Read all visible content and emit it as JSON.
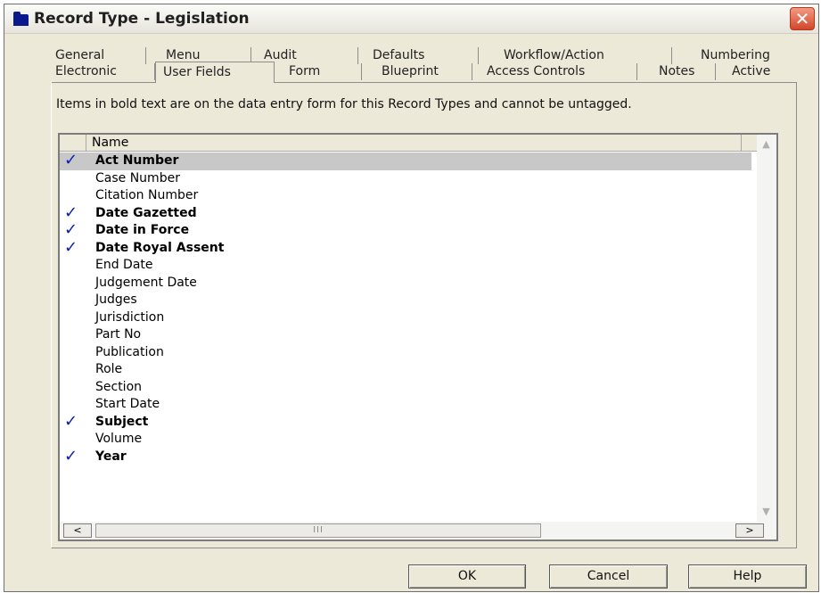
{
  "window": {
    "title": "Record Type - Legislation",
    "close_glyph": "✕"
  },
  "tabs": {
    "row1": [
      "General",
      "Menu",
      "Audit",
      "Defaults",
      "Workflow/Action",
      "Numbering"
    ],
    "row2": [
      "Electronic",
      "User Fields",
      "Form",
      "Blueprint",
      "Access Controls",
      "Notes",
      "Active"
    ],
    "active": "User Fields"
  },
  "info_text": "Items in bold text are on the data entry form for this Record Types and cannot be untagged.",
  "list": {
    "column_header": "Name",
    "check_glyph": "✓",
    "items": [
      {
        "label": "Act Number",
        "checked": true,
        "bold": true,
        "selected": true
      },
      {
        "label": "Case Number",
        "checked": false,
        "bold": false,
        "selected": false
      },
      {
        "label": "Citation Number",
        "checked": false,
        "bold": false,
        "selected": false
      },
      {
        "label": "Date Gazetted",
        "checked": true,
        "bold": true,
        "selected": false
      },
      {
        "label": "Date in Force",
        "checked": true,
        "bold": true,
        "selected": false
      },
      {
        "label": "Date Royal Assent",
        "checked": true,
        "bold": true,
        "selected": false
      },
      {
        "label": "End Date",
        "checked": false,
        "bold": false,
        "selected": false
      },
      {
        "label": "Judgement Date",
        "checked": false,
        "bold": false,
        "selected": false
      },
      {
        "label": "Judges",
        "checked": false,
        "bold": false,
        "selected": false
      },
      {
        "label": "Jurisdiction",
        "checked": false,
        "bold": false,
        "selected": false
      },
      {
        "label": "Part No",
        "checked": false,
        "bold": false,
        "selected": false
      },
      {
        "label": "Publication",
        "checked": false,
        "bold": false,
        "selected": false
      },
      {
        "label": "Role",
        "checked": false,
        "bold": false,
        "selected": false
      },
      {
        "label": "Section",
        "checked": false,
        "bold": false,
        "selected": false
      },
      {
        "label": "Start Date",
        "checked": false,
        "bold": false,
        "selected": false
      },
      {
        "label": "Subject",
        "checked": true,
        "bold": true,
        "selected": false
      },
      {
        "label": "Volume",
        "checked": false,
        "bold": false,
        "selected": false
      },
      {
        "label": "Year",
        "checked": true,
        "bold": true,
        "selected": false
      }
    ]
  },
  "scrollbar": {
    "left_arrow": "<",
    "right_arrow": ">",
    "thumb_grip": "III",
    "up_arrow": "▲",
    "down_arrow": "▼"
  },
  "buttons": {
    "ok": "OK",
    "cancel": "Cancel",
    "help": "Help"
  },
  "colors": {
    "dialog_bg": "#ece9d8",
    "check": "#0a1fb0",
    "selection": "#c8c8c8",
    "close_button": "#d2462a"
  }
}
